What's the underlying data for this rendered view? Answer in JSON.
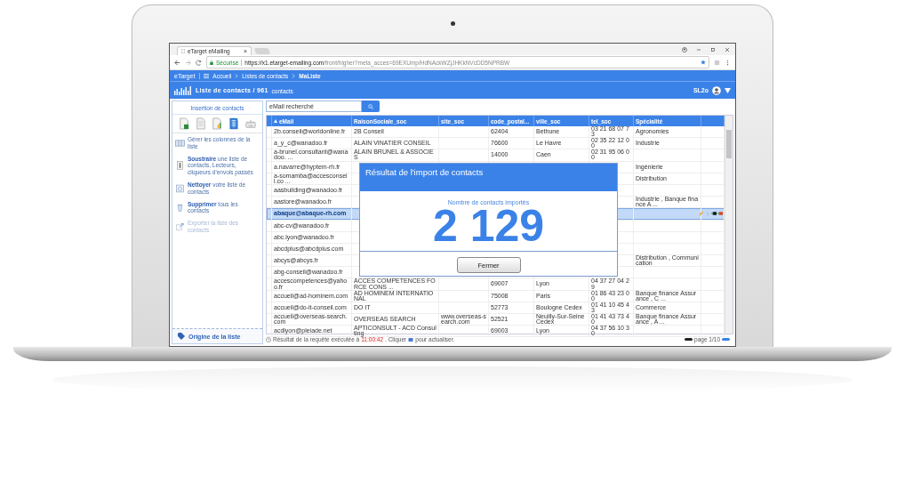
{
  "browser": {
    "tab": {
      "title": "eTarget eMailing",
      "close": "×"
    },
    "address": {
      "secure_label": "Sécurisé",
      "url_host": "https://x1.etarget-emailing.com",
      "url_path": "/front/higher?meta_acces=69EXUmp/HdNAckWZjJHKkNVcDD5NPRBW"
    }
  },
  "app_bar": {
    "brand": "eTarget",
    "breadcrumbs": [
      {
        "label": "Accueil",
        "current": false
      },
      {
        "label": "Listes de contacts",
        "current": false
      },
      {
        "label": "MaListe",
        "current": true
      }
    ]
  },
  "header": {
    "title": "Liste de contacts / 961",
    "subtitle": "contacts",
    "user": "SL2o"
  },
  "sidebar": {
    "title": "Insertion de contacts",
    "items": [
      {
        "kind": "columns",
        "text": "Gérer les colonnes de la liste",
        "disabled": false
      },
      {
        "kind": "subtract",
        "text": "**Soustraire** une liste de contacts, Lecteurs, cliqueurs d'envois passés",
        "disabled": false
      },
      {
        "kind": "clean",
        "text": "**Nettoyer** votre liste de contacts",
        "disabled": false
      },
      {
        "kind": "trash",
        "text": "**Supprimer** tous les contacts",
        "disabled": false
      },
      {
        "kind": "export",
        "text": "Exporter la liste des contacts",
        "disabled": true
      }
    ],
    "footer": "Origine de la liste"
  },
  "search": {
    "value": "eMail recherché"
  },
  "table": {
    "columns": [
      {
        "label": "eMail",
        "sorted": true
      },
      {
        "label": "RaisonSociale_soc",
        "sorted": false
      },
      {
        "label": "site_soc",
        "sorted": false
      },
      {
        "label": "code_postal...",
        "sorted": false
      },
      {
        "label": "ville_soc",
        "sorted": false
      },
      {
        "label": "tel_soc",
        "sorted": false
      },
      {
        "label": "Spécialité",
        "sorted": false
      }
    ],
    "rows": [
      {
        "cells": [
          "2b.conseil@worldonline.fr",
          "2B Conseil",
          "",
          "62404",
          "Bethune",
          "03 21 68 07 73",
          "Agronomies"
        ],
        "selected": false
      },
      {
        "cells": [
          "a_y_c@wanadoo.fr",
          "ALAIN VINATIER CONSEIL",
          "",
          "76600",
          "Le Havre",
          "02 35 22 12 00",
          "Industrie"
        ],
        "selected": false
      },
      {
        "cells": [
          "a-brunel.consultant@wanadoo. ...",
          "ALAIN BRUNEL & ASSOCIES",
          "",
          "14000",
          "Caen",
          "02 31 95 06 00",
          ""
        ],
        "selected": false
      },
      {
        "cells": [
          "a.navarre@hyptem-rh.fr",
          "",
          "",
          "",
          "",
          "",
          "Ingénierie"
        ],
        "selected": false
      },
      {
        "cells": [
          "a-somamba@accesconseil.co ...",
          "",
          "",
          "",
          "",
          "",
          "Distribution"
        ],
        "selected": false
      },
      {
        "cells": [
          "aasbuilding@wanadoo.fr",
          "",
          "",
          "",
          "",
          "",
          ""
        ],
        "selected": false
      },
      {
        "cells": [
          "aastore@wanadoo.fr",
          "",
          "",
          "",
          "",
          "",
          "Industrie , Banque finance A ..."
        ],
        "selected": false
      },
      {
        "cells": [
          "abaque@abaque-rh.com",
          "",
          "",
          "",
          "",
          "",
          ""
        ],
        "selected": true
      },
      {
        "cells": [
          "abc-cv@wanadoo.fr",
          "",
          "",
          "",
          "",
          "",
          ""
        ],
        "selected": false
      },
      {
        "cells": [
          "abc.lyon@wanadoo.fr",
          "",
          "",
          "",
          "",
          "",
          ""
        ],
        "selected": false
      },
      {
        "cells": [
          "abcdplus@abcdplus.com",
          "",
          "",
          "",
          "",
          "",
          ""
        ],
        "selected": false
      },
      {
        "cells": [
          "abcys@abcys.fr",
          "",
          "",
          "",
          "",
          "",
          "Distribution , Communication"
        ],
        "selected": false
      },
      {
        "cells": [
          "abg-conseil@wanadoo.fr",
          "",
          "",
          "",
          "",
          "",
          ""
        ],
        "selected": false
      },
      {
        "cells": [
          "accescompetences@yahoo.fr",
          "ACCES COMPETENCES FORCE CONS ...",
          "",
          "69007",
          "Lyon",
          "04 37 27 04 29",
          ""
        ],
        "selected": false
      },
      {
        "cells": [
          "accueil@ad-hominem.com",
          "AD HOMINEM INTERNATIONAL",
          "",
          "75008",
          "Paris",
          "01 86 43 23 00",
          "Banque finance Assurance , C ..."
        ],
        "selected": false
      },
      {
        "cells": [
          "accueil@do-it-conseil.com",
          "DO IT",
          "",
          "52773",
          "Boulogne Cedex",
          "01 41 10 45 43",
          "Commerce"
        ],
        "selected": false
      },
      {
        "cells": [
          "accueil@overseas-search.com",
          "OVERSEAS SEARCH",
          "www.overseas-search.com",
          "52521",
          "Neuilly-Sur-Seine Cedex",
          "01 41 43 73 40",
          "Banque finance Assurance , A ..."
        ],
        "selected": false
      },
      {
        "cells": [
          "acdlyon@pleiade.net",
          "APTICONSULT - ACD Consulting",
          "",
          "69003",
          "Lyon",
          "04 37 56 10 30",
          ""
        ],
        "selected": false
      }
    ]
  },
  "status": {
    "before": "Résultat de la requête exécutée à",
    "time": "11:00:42",
    "middle": ". Cliquer",
    "after": "pour actualiser.",
    "page": "page 1/10"
  },
  "modal": {
    "title": "Résultat de l'import de contacts",
    "label": "Nombre de contacts importés",
    "count": "2 129",
    "button": "Fermer"
  }
}
